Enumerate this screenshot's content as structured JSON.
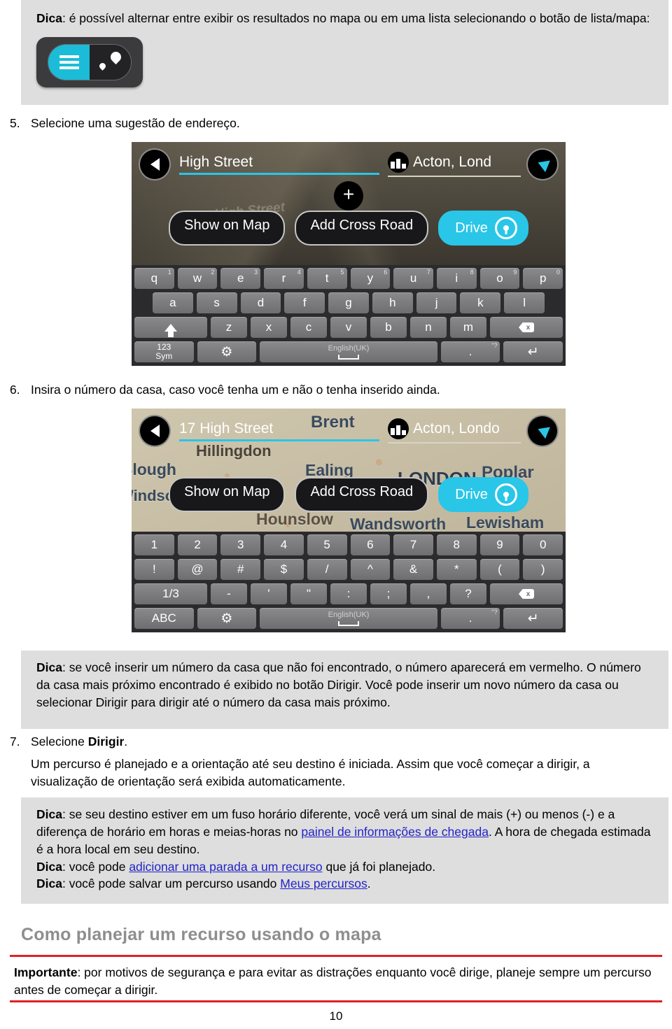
{
  "tip_box_1": {
    "lead": "Dica",
    "text": ": é possível alternar entre exibir os resultados no mapa ou em uma lista selecionando o botão de lista/mapa:",
    "icon": "list-map-toggle-button"
  },
  "step_5": {
    "number": "5.",
    "text": "Selecione uma sugestão de endereço."
  },
  "step_6": {
    "number": "6.",
    "text": "Insira o número da casa, caso você tenha um e não o tenha inserido ainda."
  },
  "step_7": {
    "number": "7.",
    "text_before": "Selecione ",
    "bold": "Dirigir",
    "text_after": ".",
    "paragraph": "Um percurso é planejado e a orientação até seu destino é iniciada. Assim que você começar a dirigir, a visualização de orientação será exibida automaticamente."
  },
  "tip_box_2": {
    "lead": "Dica",
    "text": ": se você inserir um número da casa que não foi encontrado, o número aparecerá em vermelho. O número da casa mais próximo encontrado é exibido no botão Dirigir. Você pode inserir um novo número da casa ou selecionar Dirigir para dirigir até o número da casa mais próximo."
  },
  "tip_box_3": {
    "tips": [
      {
        "lead": "Dica",
        "part1": ": se seu destino estiver em um fuso horário diferente, você verá um sinal de mais (+) ou menos (-) e a diferença de horário em horas e meias-horas no ",
        "link": "painel de informações de chegada",
        "part2": ". A hora de chegada estimada é a hora local em seu destino."
      },
      {
        "lead": "Dica",
        "part1": ": você pode ",
        "link": "adicionar uma parada a um recurso",
        "part2": " que já foi planejado."
      },
      {
        "lead": "Dica",
        "part1": ": você pode salvar um percurso usando ",
        "link": "Meus percursos",
        "part2": "."
      }
    ]
  },
  "section_heading": "Como planejar um recurso usando o mapa",
  "important_box": {
    "lead": "Importante",
    "text": ": por motivos de segurança e para evitar as distrações enquanto você dirige, planeje sempre um percurso antes de começar a dirigir."
  },
  "page_number": "10",
  "colors": {
    "tip_bg": "#dedede",
    "link": "#2323c8",
    "important_rule": "#e12026",
    "heading": "#8e8e8e",
    "device_accent": "#29c6e8"
  },
  "screenshot_1": {
    "back_icon": "back-arrow-icon",
    "street_value": "High Street",
    "city_icon": "city-buildings-icon",
    "city_value": "Acton, Lond",
    "compass_icon": "compass-arrow-icon",
    "map_label": "High Street",
    "add_pin_label": "+",
    "buttons": {
      "show_on_map": "Show on Map",
      "add_cross_road": "Add Cross Road",
      "drive": "Drive"
    },
    "keyboard": {
      "row1": [
        {
          "key": "q",
          "sup": "1"
        },
        {
          "key": "w",
          "sup": "2"
        },
        {
          "key": "e",
          "sup": "3"
        },
        {
          "key": "r",
          "sup": "4"
        },
        {
          "key": "t",
          "sup": "5"
        },
        {
          "key": "y",
          "sup": "6"
        },
        {
          "key": "u",
          "sup": "7"
        },
        {
          "key": "i",
          "sup": "8"
        },
        {
          "key": "o",
          "sup": "9"
        },
        {
          "key": "p",
          "sup": "0"
        }
      ],
      "row2": [
        "a",
        "s",
        "d",
        "f",
        "g",
        "h",
        "j",
        "k",
        "l"
      ],
      "row3": [
        "z",
        "x",
        "c",
        "v",
        "b",
        "n",
        "m"
      ],
      "shift_key": "shift-icon",
      "backspace_key": "backspace-icon",
      "mode_key_line1": "123",
      "mode_key_line2": "Sym",
      "settings_key": "gear-icon",
      "space_label": "English(UK)",
      "punct_key": ".",
      "punct_sup": "\"?",
      "enter_key": "enter-icon"
    }
  },
  "screenshot_2": {
    "back_icon": "back-arrow-icon",
    "street_value": "17 High Street",
    "city_icon": "city-buildings-icon",
    "city_value": "Acton, Londo",
    "compass_icon": "compass-arrow-icon",
    "buttons": {
      "show_on_map": "Show on Map",
      "add_cross_road": "Add Cross Road",
      "drive": "Drive"
    },
    "map_labels": [
      "Brent",
      "Hillingdon",
      "Ealing",
      "LONDON",
      "Poplar",
      "Slough",
      "Windsor",
      "Hounslow",
      "Wandsworth",
      "Lewisham"
    ],
    "keyboard": {
      "row1": [
        "1",
        "2",
        "3",
        "4",
        "5",
        "6",
        "7",
        "8",
        "9",
        "0"
      ],
      "row2": [
        "!",
        "@",
        "#",
        "$",
        "/",
        "^",
        "&",
        "*",
        "(",
        ")"
      ],
      "row3_page": "1/3",
      "row3": [
        "-",
        "'",
        "\"",
        ":",
        ";",
        ",",
        "?"
      ],
      "backspace_key": "backspace-icon",
      "mode_key": "ABC",
      "settings_key": "gear-icon",
      "space_label": "English(UK)",
      "punct_key": ".",
      "punct_sup": "\"?",
      "enter_key": "enter-icon"
    }
  }
}
